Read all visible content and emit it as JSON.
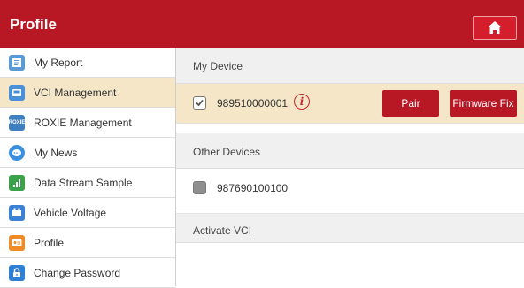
{
  "header": {
    "title": "Profile",
    "home_icon": "home-icon"
  },
  "sidebar": {
    "items": [
      {
        "label": "My Report",
        "icon": "report-icon",
        "color": "#5b9bd5"
      },
      {
        "label": "VCI Management",
        "icon": "vci-icon",
        "color": "#4a90d9",
        "active": true
      },
      {
        "label": "ROXIE Management",
        "icon": "roxie-icon",
        "icon_text": "ROXIE",
        "color": "#3f7fbf"
      },
      {
        "label": "My News",
        "icon": "chat-bubble-icon",
        "color": "#3b8fe0"
      },
      {
        "label": "Data Stream Sample",
        "icon": "signal-chart-icon",
        "color": "#3aa34a"
      },
      {
        "label": "Vehicle Voltage",
        "icon": "battery-icon",
        "color": "#3b82d6"
      },
      {
        "label": "Profile",
        "icon": "id-card-icon",
        "color": "#f08a24"
      },
      {
        "label": "Change Password",
        "icon": "lock-icon",
        "color": "#2e7fd6"
      }
    ]
  },
  "main": {
    "my_device": {
      "title": "My Device",
      "serial": "989510000001",
      "checked": true,
      "pair_label": "Pair",
      "firmware_label": "Firmware Fix"
    },
    "other_devices": {
      "title": "Other Devices",
      "serial": "987690100100",
      "checked": false
    },
    "activate": {
      "title": "Activate VCI"
    }
  },
  "colors": {
    "accent": "#b81724",
    "selected_row": "#f4e6c7"
  }
}
